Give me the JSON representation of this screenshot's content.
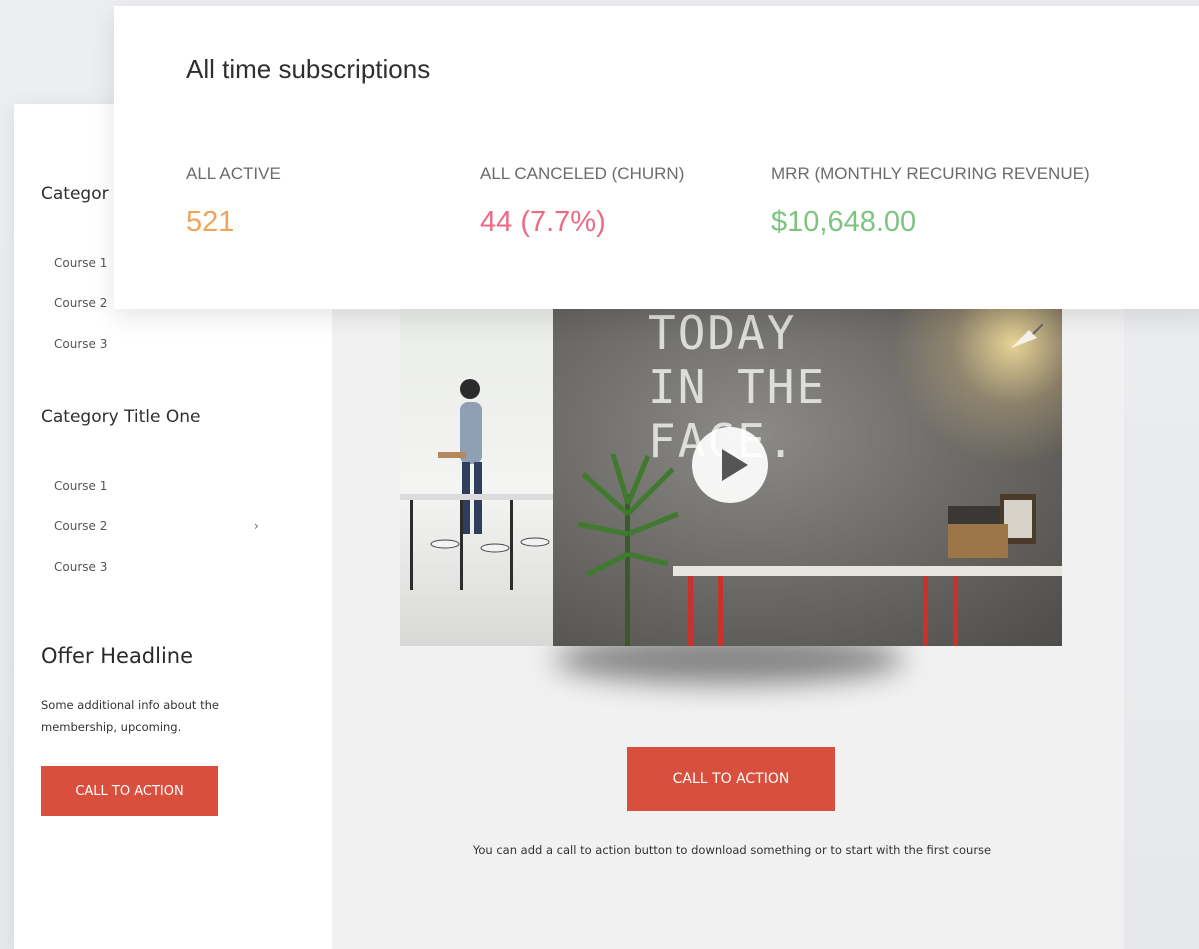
{
  "subscriptions_card": {
    "title": "All time subscriptions",
    "stats": [
      {
        "label": "ALL ACTIVE",
        "value": "521",
        "color": "#f0a45a"
      },
      {
        "label": "ALL CANCELED (CHURN)",
        "value": "44 (7.7%)",
        "color": "#ee6a84"
      },
      {
        "label": "MRR (MONTHLY RECURING REVENUE)",
        "value": "$10,648.00",
        "color": "#7cc47f"
      }
    ]
  },
  "sidebar": {
    "category_1": {
      "title": "Categor",
      "courses": [
        "Course 1",
        "Course 2",
        "Course 3"
      ]
    },
    "category_2": {
      "title": "Category Title One",
      "courses": [
        "Course 1",
        "Course 2",
        "Course 3"
      ],
      "chevron": "›"
    },
    "offer": {
      "headline": "Offer Headline",
      "text": "Some additional info about the membership, upcoming.",
      "cta_label": "CALL TO ACTION"
    }
  },
  "main": {
    "video": {
      "wall_text": "TODAY\nIN THE\nFACE."
    },
    "cta_label": "CALL TO ACTION",
    "cta_caption": "You can add a call to action button to download something or to start with the first course"
  },
  "colors": {
    "accent_red": "#d94f3d"
  }
}
